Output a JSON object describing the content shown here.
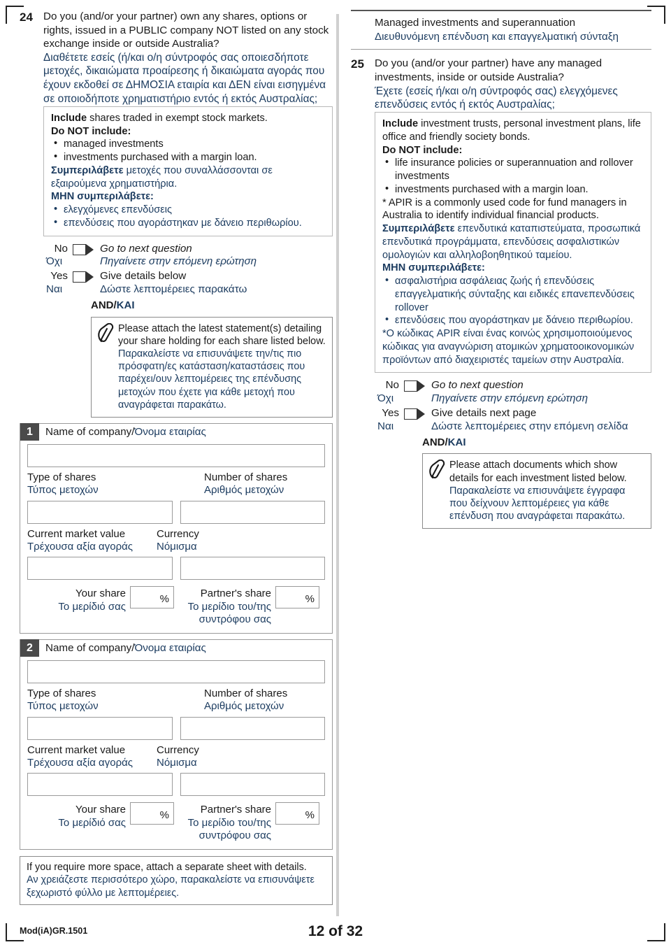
{
  "document": {
    "footer_code": "Mod(iA)GR.1501",
    "page_label": "12 of 32"
  },
  "question_24": {
    "number": "24",
    "text_en": "Do you (and/or your partner) own any shares, options or rights, issued in a PUBLIC company NOT listed on any stock exchange inside or outside Australia?",
    "text_gr": "Διαθέτετε εσείς (ή/και ο/η σύντροφός σας οποιεσδήποτε μετοχές, δικαιώματα προαίρεσης ή δικαιώματα αγοράς που έχουν εκδοθεί σε ΔΗΜΟΣΙΑ εταιρία και ΔΕΝ είναι εισηγμένα σε οποιοδήποτε χρηματιστήριο εντός ή εκτός Αυστραλίας;",
    "instructions": {
      "include_label_en": "Include",
      "include_text_en": " shares traded in exempt stock markets.",
      "exclude_label_en": "Do NOT include:",
      "exclude_items_en": [
        "managed investments",
        "investments purchased with a margin loan."
      ],
      "include_label_gr": "Συμπεριλάβετε",
      "include_text_gr": " μετοχές που συναλλάσσονται σε εξαιρούμενα χρηματιστήρια.",
      "exclude_label_gr": "ΜΗΝ συμπεριλάβετε:",
      "exclude_items_gr": [
        "ελεγχόμενες επενδύσεις",
        "επενδύσεις που αγοράστηκαν με δάνειο περιθωρίου."
      ]
    },
    "answers": {
      "no_en": "No",
      "no_gr": "Όχι",
      "no_action_en": "Go to next question",
      "no_action_gr": "Πηγαίνετε στην επόμενη ερώτηση",
      "yes_en": "Yes",
      "yes_gr": "Ναι",
      "yes_action_en": "Give details below",
      "yes_action_gr": "Δώστε λεπτομέρειες παρακάτω",
      "and_en": "AND/",
      "and_gr": "ΚΑΙ"
    },
    "attachment": {
      "icon": "paperclip-icon",
      "text_en": "Please attach the latest statement(s) detailing your share holding for each share listed below.",
      "text_gr": "Παρακαλείστε να επισυνάψετε την/τις πιο πρόσφατη/ες κατάσταση/καταστάσεις που παρέχει/ουν λεπτομέρειες της επένδυσης μετοχών που έχετε για κάθε μετοχή που αναγράφεται παρακάτω."
    },
    "note_en": "If you require more space, attach a separate sheet with details.",
    "note_gr": "Αν χρειάζεστε περισσότερο χώρο, παρακαλείστε να επισυνάψετε ξεχωριστό φύλλο με λεπτομέρειες."
  },
  "company_entries": [
    {
      "badge": "1",
      "name_label_en": "Name of company/",
      "name_label_gr": "Όνομα εταιρίας",
      "name_value": "",
      "type_label_en": "Type of shares",
      "type_label_gr": "Τύπος μετοχών",
      "type_value": "",
      "number_label_en": "Number of shares",
      "number_label_gr": "Αριθμός μετοχών",
      "number_value": "",
      "value_label_en": "Current market value",
      "value_label_gr": "Τρέχουσα αξία αγοράς",
      "value_value": "",
      "currency_label_en": "Currency",
      "currency_label_gr": "Νόμισμα",
      "currency_value": "",
      "your_share_en": "Your share",
      "your_share_gr": "Το μερίδιό σας",
      "your_share_value": "",
      "partner_share_en": "Partner's share",
      "partner_share_gr": "Το μερίδιο του/της συντρόφου σας",
      "partner_share_value": "",
      "percent_symbol": "%"
    },
    {
      "badge": "2",
      "name_label_en": "Name of company/",
      "name_label_gr": "Όνομα εταιρίας",
      "name_value": "",
      "type_label_en": "Type of shares",
      "type_label_gr": "Τύπος μετοχών",
      "type_value": "",
      "number_label_en": "Number of shares",
      "number_label_gr": "Αριθμός μετοχών",
      "number_value": "",
      "value_label_en": "Current market value",
      "value_label_gr": "Τρέχουσα αξία αγοράς",
      "value_value": "",
      "currency_label_en": "Currency",
      "currency_label_gr": "Νόμισμα",
      "currency_value": "",
      "your_share_en": "Your share",
      "your_share_gr": "Το μερίδιό σας",
      "your_share_value": "",
      "partner_share_en": "Partner's share",
      "partner_share_gr": "Το μερίδιο του/της συντρόφου σας",
      "partner_share_value": "",
      "percent_symbol": "%"
    }
  ],
  "section_header": {
    "title_en": "Managed investments and superannuation",
    "title_gr": "Διευθυνόμενη επένδυση και επαγγελματική σύνταξη"
  },
  "question_25": {
    "number": "25",
    "text_en": "Do you (and/or your partner) have any managed investments, inside or outside Australia?",
    "text_gr": "Έχετε (εσείς ή/και ο/η σύντροφός σας) ελεγχόμενες επενδύσεις εντός ή εκτός Αυστραλίας;",
    "instructions": {
      "include_label_en": "Include",
      "include_text_en": " investment trusts, personal investment plans, life office and friendly society bonds.",
      "exclude_label_en": "Do NOT include:",
      "exclude_items_en": [
        "life insurance policies or superannuation and rollover investments",
        "investments purchased with a margin loan."
      ],
      "apir_note_en": "* APIR is a commonly used code for fund managers in Australia to identify individual financial products.",
      "include_label_gr": "Συμπεριλάβετε",
      "include_text_gr": " επενδυτικά καταπιστεύματα, προσωπικά επενδυτικά προγράμματα, επενδύσεις ασφαλιστικών ομολογιών και αλληλοβοηθητικού ταμείου.",
      "exclude_label_gr": "ΜΗΝ συμπεριλάβετε:",
      "exclude_items_gr": [
        "ασφαλιστήρια ασφάλειας ζωής ή επενδύσεις επαγγελματικής σύνταξης και ειδικές επανεπενδύσεις rollover",
        "επενδύσεις που αγοράστηκαν με δάνειο περιθωρίου."
      ],
      "apir_note_gr": "*Ο κώδικας APIR είναι ένας κοινώς χρησιμοποιούμενος κώδικας για αναγνώριση ατομικών χρηματοοικονομικών προϊόντων από διαχειριστές ταμείων στην Αυστραλία."
    },
    "answers": {
      "no_en": "No",
      "no_gr": "Όχι",
      "no_action_en": "Go to next question",
      "no_action_gr": "Πηγαίνετε στην επόμενη ερώτηση",
      "yes_en": "Yes",
      "yes_gr": "Ναι",
      "yes_action_en": "Give details next page",
      "yes_action_gr": "Δώστε λεπτομέρειες στην επόμενη σελίδα",
      "and_en": "AND/",
      "and_gr": "ΚΑΙ"
    },
    "attachment": {
      "icon": "paperclip-icon",
      "text_en": "Please attach documents which show details for each investment listed below.",
      "text_gr": "Παρακαλείστε να επισυνάψετε έγγραφα που δείχνουν λεπτομέρειες για κάθε επένδυση που αναγράφεται παρακάτω."
    }
  },
  "colors": {
    "greek_text": "#1b3b5f",
    "english_text": "#1a1a1a",
    "badge_bg": "#4a4a4a"
  }
}
